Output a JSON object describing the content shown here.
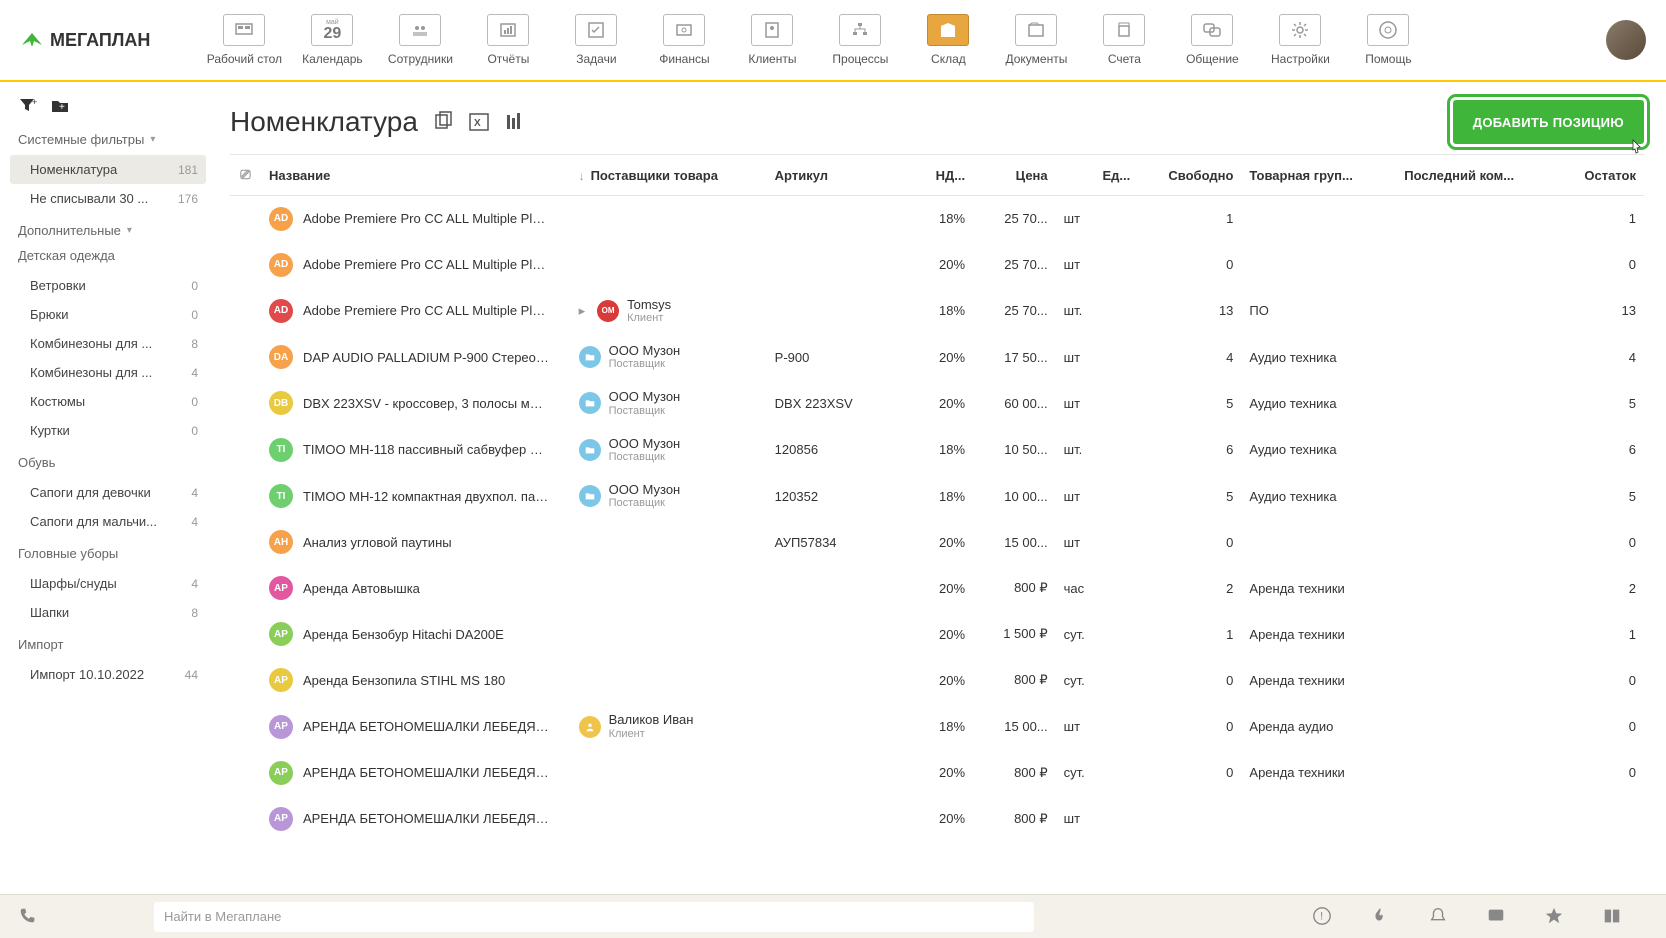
{
  "logo": "МЕГАПЛАН",
  "nav": [
    {
      "label": "Рабочий стол",
      "key": "desktop"
    },
    {
      "label": "Календарь",
      "key": "calendar",
      "badge": "май 29"
    },
    {
      "label": "Сотрудники",
      "key": "employees"
    },
    {
      "label": "Отчёты",
      "key": "reports"
    },
    {
      "label": "Задачи",
      "key": "tasks"
    },
    {
      "label": "Финансы",
      "key": "finance"
    },
    {
      "label": "Клиенты",
      "key": "clients"
    },
    {
      "label": "Процессы",
      "key": "processes"
    },
    {
      "label": "Склад",
      "key": "warehouse",
      "active": true
    },
    {
      "label": "Документы",
      "key": "documents"
    },
    {
      "label": "Счета",
      "key": "invoices"
    },
    {
      "label": "Общение",
      "key": "chat"
    },
    {
      "label": "Настройки",
      "key": "settings"
    },
    {
      "label": "Помощь",
      "key": "help"
    }
  ],
  "sidebar": {
    "groups": [
      {
        "title": "Системные фильтры",
        "items": [
          {
            "label": "Номенклатура",
            "count": "181",
            "active": true
          },
          {
            "label": "Не списывали 30 ...",
            "count": "176"
          }
        ]
      },
      {
        "title": "Дополнительные",
        "items": []
      },
      {
        "title": "Детская одежда",
        "plain": true,
        "items": [
          {
            "label": "Ветровки",
            "count": "0"
          },
          {
            "label": "Брюки",
            "count": "0"
          },
          {
            "label": "Комбинезоны для ...",
            "count": "8"
          },
          {
            "label": "Комбинезоны для ...",
            "count": "4"
          },
          {
            "label": "Костюмы",
            "count": "0"
          },
          {
            "label": "Куртки",
            "count": "0"
          }
        ]
      },
      {
        "title": "Обувь",
        "plain": true,
        "items": [
          {
            "label": "Сапоги для девочки",
            "count": "4"
          },
          {
            "label": "Сапоги для мальчи...",
            "count": "4"
          }
        ]
      },
      {
        "title": "Головные уборы",
        "plain": true,
        "items": [
          {
            "label": "Шарфы/снуды",
            "count": "4"
          },
          {
            "label": "Шапки",
            "count": "8"
          }
        ]
      },
      {
        "title": "Импорт",
        "plain": true,
        "items": [
          {
            "label": "Импорт 10.10.2022",
            "count": "44"
          }
        ]
      }
    ]
  },
  "page": {
    "title": "Номенклатура",
    "add_btn": "ДОБАВИТЬ ПОЗИЦИЮ",
    "search_placeholder": "Найти в Мегаплане"
  },
  "columns": [
    "",
    "Название",
    "Поставщики товара",
    "Артикул",
    "НД...",
    "Цена",
    "Ед...",
    "Свободно",
    "Товарная груп...",
    "Последний ком...",
    "Остаток"
  ],
  "rows": [
    {
      "badge": "AD",
      "bcolor": "#f7a24a",
      "name": "Adobe Premiere Pro CC ALL Multiple Platfo...",
      "supplier": null,
      "art": "",
      "vat": "18%",
      "price": "25 70...",
      "unit": "шт",
      "free": "1",
      "group": "",
      "comment": "",
      "stock": "1"
    },
    {
      "badge": "AD",
      "bcolor": "#f7a24a",
      "name": "Adobe Premiere Pro CC ALL Multiple Platfo...",
      "supplier": null,
      "art": "",
      "vat": "20%",
      "price": "25 70...",
      "unit": "шт",
      "free": "0",
      "group": "",
      "comment": "",
      "stock": "0"
    },
    {
      "badge": "AD",
      "bcolor": "#e14a4a",
      "name": "Adobe Premiere Pro CC ALL Multiple Platfo...",
      "supplier": {
        "icon": "om",
        "t": "Tomsys",
        "s": "Клиент",
        "caret": true
      },
      "art": "",
      "vat": "18%",
      "price": "25 70...",
      "unit": "шт.",
      "free": "13",
      "group": "ПО",
      "comment": "",
      "stock": "13"
    },
    {
      "badge": "DA",
      "bcolor": "#f7a24a",
      "name": "DAP AUDIO PALLADIUM P-900 Стерео уси...",
      "supplier": {
        "icon": "folder",
        "t": "ООО Музон",
        "s": "Поставщик"
      },
      "art": "P-900",
      "vat": "20%",
      "price": "17 50...",
      "unit": "шт",
      "free": "4",
      "group": "Аудио техника",
      "comment": "",
      "stock": "4"
    },
    {
      "badge": "DB",
      "bcolor": "#e8c93f",
      "name": "DBX 223XSV - кроссовер, 3 полосы моно-,...",
      "supplier": {
        "icon": "folder",
        "t": "ООО Музон",
        "s": "Поставщик"
      },
      "art": "DBX 223XSV",
      "vat": "20%",
      "price": "60 00...",
      "unit": "шт",
      "free": "5",
      "group": "Аудио техника",
      "comment": "",
      "stock": "5"
    },
    {
      "badge": "TI",
      "bcolor": "#6dcf6d",
      "name": "TIMOO MH-118 пассивный сабвуфер 18 \",...",
      "supplier": {
        "icon": "folder",
        "t": "ООО Музон",
        "s": "Поставщик"
      },
      "art": "120856",
      "vat": "18%",
      "price": "10 50...",
      "unit": "шт.",
      "free": "6",
      "group": "Аудио техника",
      "comment": "",
      "stock": "6"
    },
    {
      "badge": "TI",
      "bcolor": "#6dcf6d",
      "name": "TIMOO MH-12 компактная двухпол. пасс...",
      "supplier": {
        "icon": "folder",
        "t": "ООО Музон",
        "s": "Поставщик"
      },
      "art": "120352",
      "vat": "18%",
      "price": "10 00...",
      "unit": "шт",
      "free": "5",
      "group": "Аудио техника",
      "comment": "",
      "stock": "5"
    },
    {
      "badge": "АН",
      "bcolor": "#f7a24a",
      "name": "Анализ угловой паутины",
      "supplier": null,
      "art": "АУП57834",
      "vat": "20%",
      "price": "15 00...",
      "unit": "шт",
      "free": "0",
      "group": "",
      "comment": "",
      "stock": "0"
    },
    {
      "badge": "АР",
      "bcolor": "#e356a0",
      "name": "Аренда Автовышка",
      "supplier": null,
      "art": "",
      "vat": "20%",
      "price": "800 ₽",
      "unit": "час",
      "free": "2",
      "group": "Аренда техники",
      "comment": "",
      "stock": "2"
    },
    {
      "badge": "АР",
      "bcolor": "#8ace5a",
      "name": "Аренда Бензобур Hitachi DA200E",
      "supplier": null,
      "art": "",
      "vat": "20%",
      "price": "1 500 ₽",
      "unit": "сут.",
      "free": "1",
      "group": "Аренда техники",
      "comment": "",
      "stock": "1"
    },
    {
      "badge": "АР",
      "bcolor": "#e8c93f",
      "name": "Аренда Бензопила STIHL MS 180",
      "supplier": null,
      "art": "",
      "vat": "20%",
      "price": "800 ₽",
      "unit": "сут.",
      "free": "0",
      "group": "Аренда техники",
      "comment": "",
      "stock": "0"
    },
    {
      "badge": "АР",
      "bcolor": "#b896d8",
      "name": "АРЕНДА БЕТОНОМЕШАЛКИ ЛЕБЕДЯНЬ ...",
      "supplier": {
        "icon": "person",
        "t": "Валиков Иван",
        "s": "Клиент"
      },
      "art": "",
      "vat": "18%",
      "price": "15 00...",
      "unit": "шт",
      "free": "0",
      "group": "Аренда аудио",
      "comment": "",
      "stock": "0"
    },
    {
      "badge": "АР",
      "bcolor": "#8ace5a",
      "name": "АРЕНДА БЕТОНОМЕШАЛКИ ЛЕБЕДЯНЬ ...",
      "supplier": null,
      "art": "",
      "vat": "20%",
      "price": "800 ₽",
      "unit": "сут.",
      "free": "0",
      "group": "Аренда техники",
      "comment": "",
      "stock": "0"
    },
    {
      "badge": "АР",
      "bcolor": "#b896d8",
      "name": "АРЕНДА БЕТОНОМЕШАЛКИ ЛЕБЕДЯНЬ ...",
      "supplier": null,
      "art": "",
      "vat": "20%",
      "price": "800 ₽",
      "unit": "шт",
      "free": "",
      "group": "",
      "comment": "",
      "stock": ""
    }
  ]
}
